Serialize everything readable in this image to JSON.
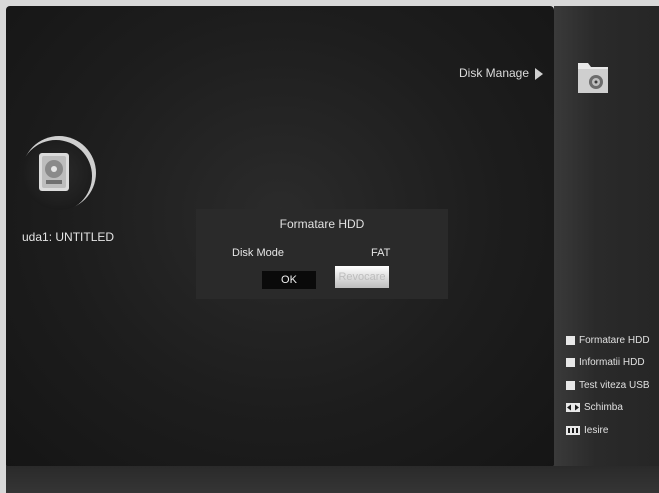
{
  "menu": {
    "title": "Disk Manage"
  },
  "disk": {
    "label": "uda1: UNTITLED"
  },
  "dialog": {
    "title": "Formatare HDD",
    "field_label": "Disk Mode",
    "field_value": "FAT",
    "ok_label": "OK",
    "cancel_label": "Revocare"
  },
  "legend": [
    {
      "icon": "white-square-icon",
      "label": "Formatare HDD"
    },
    {
      "icon": "white-square-icon",
      "label": "Informatii HDD"
    },
    {
      "icon": "white-square-icon",
      "label": "Test viteza USB"
    },
    {
      "icon": "left-right-arrows-icon",
      "label": "Schimba"
    },
    {
      "icon": "exit-key-icon",
      "label": "Iesire"
    }
  ]
}
